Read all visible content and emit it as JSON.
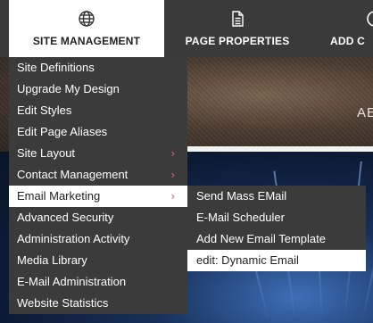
{
  "toolbar": {
    "site_management": {
      "label": "SITE MANAGEMENT",
      "icon": "globe-icon"
    },
    "page_properties": {
      "label": "PAGE PROPERTIES",
      "icon": "document-icon"
    },
    "add_content": {
      "label": "ADD C",
      "icon": "plus-icon"
    }
  },
  "page": {
    "header_title_fragment": "AE"
  },
  "menu": {
    "items": [
      {
        "label": "Site Definitions"
      },
      {
        "label": "Upgrade My Design"
      },
      {
        "label": "Edit Styles"
      },
      {
        "label": "Edit Page Aliases"
      },
      {
        "label": "Site Layout",
        "submenu_arrow": "›"
      },
      {
        "label": "Contact Management",
        "submenu_arrow": "›"
      },
      {
        "label": "Email Marketing",
        "submenu_arrow": "›"
      },
      {
        "label": "Advanced Security"
      },
      {
        "label": "Administration Activity"
      },
      {
        "label": "Media Library"
      },
      {
        "label": "E-Mail Administration"
      },
      {
        "label": "Website Statistics"
      }
    ]
  },
  "submenu": {
    "items": [
      {
        "label": "Send Mass EMail"
      },
      {
        "label": "E-Mail Scheduler"
      },
      {
        "label": "Add New Email Template"
      },
      {
        "label": "edit: Dynamic Email"
      }
    ]
  },
  "colors": {
    "menu_bg": "#3b3b3b",
    "toolbar_bg": "#3a3a3a",
    "active_bg": "#ffffff",
    "submenu_arrow": "#d6688a"
  }
}
